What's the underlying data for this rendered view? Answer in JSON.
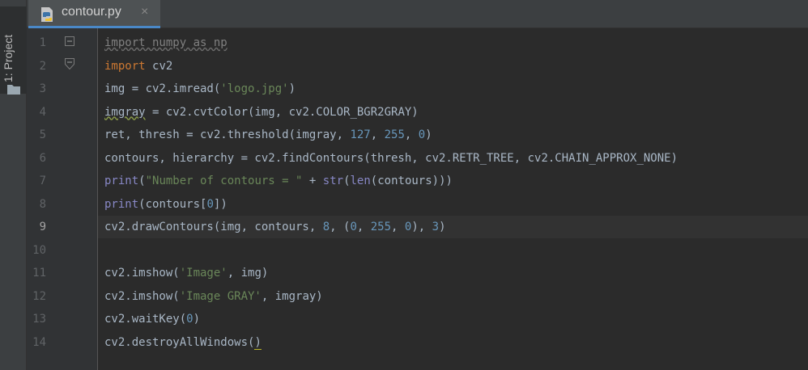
{
  "sidebar": {
    "project_label": "1: Project"
  },
  "tab": {
    "title": "contour.py",
    "close": "×"
  },
  "editor": {
    "line_numbers": [
      "1",
      "2",
      "3",
      "4",
      "5",
      "6",
      "7",
      "8",
      "9",
      "10",
      "11",
      "12",
      "13",
      "14"
    ],
    "current_line": 9,
    "lines": [
      [
        {
          "t": "import numpy as np",
          "c": "dim"
        }
      ],
      [
        {
          "t": "import ",
          "c": "kw"
        },
        {
          "t": "cv2",
          "c": ""
        }
      ],
      [
        {
          "t": "img = cv2.imread(",
          "c": ""
        },
        {
          "t": "'logo.jpg'",
          "c": "str"
        },
        {
          "t": ")",
          "c": ""
        }
      ],
      [
        {
          "t": "imgray",
          "c": "warn"
        },
        {
          "t": " = cv2.cvtColor(img, cv2.COLOR_BGR2GRAY)",
          "c": ""
        }
      ],
      [
        {
          "t": "ret, thresh = cv2.threshold(imgray, ",
          "c": ""
        },
        {
          "t": "127",
          "c": "num"
        },
        {
          "t": ", ",
          "c": ""
        },
        {
          "t": "255",
          "c": "num"
        },
        {
          "t": ", ",
          "c": ""
        },
        {
          "t": "0",
          "c": "num"
        },
        {
          "t": ")",
          "c": ""
        }
      ],
      [
        {
          "t": "contours, hierarchy = cv2.findContours(thresh, cv2.RETR_TREE, cv2.CHAIN_APPROX_NONE)",
          "c": ""
        }
      ],
      [
        {
          "t": "print",
          "c": "bi"
        },
        {
          "t": "(",
          "c": ""
        },
        {
          "t": "\"Number of contours = \"",
          "c": "str"
        },
        {
          "t": " + ",
          "c": ""
        },
        {
          "t": "str",
          "c": "bi"
        },
        {
          "t": "(",
          "c": ""
        },
        {
          "t": "len",
          "c": "bi"
        },
        {
          "t": "(contours)))",
          "c": ""
        }
      ],
      [
        {
          "t": "print",
          "c": "bi"
        },
        {
          "t": "(contours[",
          "c": ""
        },
        {
          "t": "0",
          "c": "num"
        },
        {
          "t": "])",
          "c": ""
        }
      ],
      [
        {
          "t": "cv2.drawContours(img, contours, ",
          "c": ""
        },
        {
          "t": "8",
          "c": "num"
        },
        {
          "t": ", (",
          "c": ""
        },
        {
          "t": "0",
          "c": "num"
        },
        {
          "t": ", ",
          "c": ""
        },
        {
          "t": "255",
          "c": "num"
        },
        {
          "t": ", ",
          "c": ""
        },
        {
          "t": "0",
          "c": "num"
        },
        {
          "t": "), ",
          "c": ""
        },
        {
          "t": "3",
          "c": "num"
        },
        {
          "t": ")",
          "c": ""
        }
      ],
      [],
      [
        {
          "t": "cv2.imshow(",
          "c": ""
        },
        {
          "t": "'Image'",
          "c": "str"
        },
        {
          "t": ", img)",
          "c": ""
        }
      ],
      [
        {
          "t": "cv2.imshow(",
          "c": ""
        },
        {
          "t": "'Image GRAY'",
          "c": "str"
        },
        {
          "t": ", imgray)",
          "c": ""
        }
      ],
      [
        {
          "t": "cv2.waitKey(",
          "c": ""
        },
        {
          "t": "0",
          "c": "num"
        },
        {
          "t": ")",
          "c": ""
        }
      ],
      [
        {
          "t": "cv2.destroyAllWindows(",
          "c": ""
        },
        {
          "t": ")",
          "c": "match"
        }
      ]
    ]
  },
  "colors": {
    "background": "#2b2b2b",
    "keyword": "#cc7832",
    "string": "#6a8759",
    "number": "#6897bb",
    "builtin": "#8888c6",
    "identifier": "#a9b7c6"
  },
  "icons": {
    "tab_icon": "python-file-icon",
    "project_icon": "folder-icon",
    "fold_icon": "fold-marker-icon"
  }
}
